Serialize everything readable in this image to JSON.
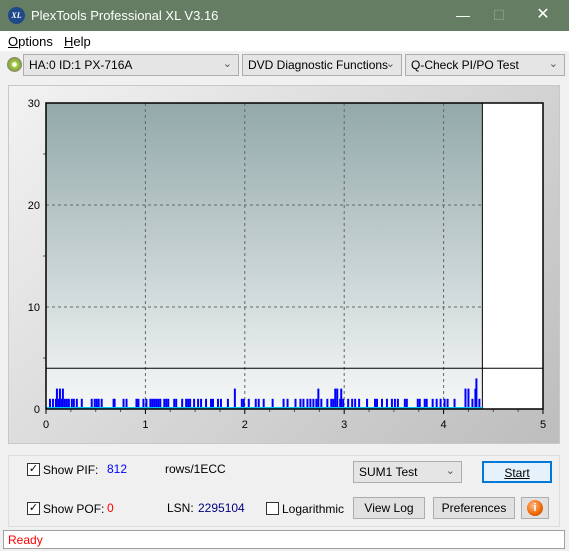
{
  "window": {
    "title": "PlexTools Professional XL V3.16",
    "logo_text": "XL"
  },
  "menu": [
    {
      "label": "Options",
      "hotkey": "O",
      "rest": "ptions"
    },
    {
      "label": "Help",
      "hotkey": "H",
      "rest": "elp"
    }
  ],
  "toolbar": {
    "drive": "HA:0 ID:1  PX-716A",
    "function": "DVD Diagnostic Functions",
    "test": "Q-Check PI/PO Test"
  },
  "chart_data": {
    "type": "bar",
    "xlim": [
      0,
      5
    ],
    "ylim": [
      0,
      30
    ],
    "x_ticks": [
      "0",
      "1",
      "2",
      "3",
      "4",
      "5"
    ],
    "y_ticks": [
      "0",
      "10",
      "20",
      "30"
    ],
    "grid": true,
    "series_color": "#0000ff",
    "threshold_line": 4,
    "end_marker_x": 4.39,
    "bars": [
      [
        0.03,
        1
      ],
      [
        0.06,
        1
      ],
      [
        0.09,
        1
      ],
      [
        0.1,
        2
      ],
      [
        0.12,
        1
      ],
      [
        0.13,
        2
      ],
      [
        0.15,
        1
      ],
      [
        0.16,
        2
      ],
      [
        0.18,
        1
      ],
      [
        0.2,
        1
      ],
      [
        0.22,
        1
      ],
      [
        0.25,
        1
      ],
      [
        0.27,
        1
      ],
      [
        0.3,
        1
      ],
      [
        0.35,
        1
      ],
      [
        0.45,
        1
      ],
      [
        0.48,
        1
      ],
      [
        0.5,
        1
      ],
      [
        0.52,
        1
      ],
      [
        0.55,
        1
      ],
      [
        0.67,
        1
      ],
      [
        0.68,
        1
      ],
      [
        0.77,
        1
      ],
      [
        0.8,
        1
      ],
      [
        0.9,
        1
      ],
      [
        0.92,
        1
      ],
      [
        0.97,
        1
      ],
      [
        1.0,
        1
      ],
      [
        1.04,
        1
      ],
      [
        1.06,
        1
      ],
      [
        1.08,
        1
      ],
      [
        1.1,
        1
      ],
      [
        1.12,
        1
      ],
      [
        1.14,
        1
      ],
      [
        1.18,
        1
      ],
      [
        1.2,
        1
      ],
      [
        1.22,
        1
      ],
      [
        1.28,
        1
      ],
      [
        1.3,
        1
      ],
      [
        1.36,
        1
      ],
      [
        1.4,
        1
      ],
      [
        1.42,
        1
      ],
      [
        1.44,
        1
      ],
      [
        1.48,
        1
      ],
      [
        1.52,
        1
      ],
      [
        1.55,
        1
      ],
      [
        1.6,
        1
      ],
      [
        1.65,
        1
      ],
      [
        1.67,
        1
      ],
      [
        1.72,
        1
      ],
      [
        1.75,
        1
      ],
      [
        1.82,
        1
      ],
      [
        1.89,
        2
      ],
      [
        1.96,
        1
      ],
      [
        1.98,
        1
      ],
      [
        2.03,
        1
      ],
      [
        2.1,
        1
      ],
      [
        2.13,
        1
      ],
      [
        2.18,
        1
      ],
      [
        2.27,
        1
      ],
      [
        2.38,
        1
      ],
      [
        2.42,
        1
      ],
      [
        2.5,
        1
      ],
      [
        2.55,
        1
      ],
      [
        2.58,
        1
      ],
      [
        2.62,
        1
      ],
      [
        2.65,
        1
      ],
      [
        2.68,
        1
      ],
      [
        2.71,
        1
      ],
      [
        2.73,
        2
      ],
      [
        2.76,
        1
      ],
      [
        2.82,
        1
      ],
      [
        2.86,
        1
      ],
      [
        2.88,
        1
      ],
      [
        2.9,
        2
      ],
      [
        2.92,
        2
      ],
      [
        2.95,
        1
      ],
      [
        2.96,
        2
      ],
      [
        2.98,
        1
      ],
      [
        3.03,
        1
      ],
      [
        3.07,
        1
      ],
      [
        3.1,
        1
      ],
      [
        3.14,
        1
      ],
      [
        3.22,
        1
      ],
      [
        3.3,
        1
      ],
      [
        3.32,
        1
      ],
      [
        3.37,
        1
      ],
      [
        3.42,
        1
      ],
      [
        3.47,
        1
      ],
      [
        3.5,
        1
      ],
      [
        3.53,
        1
      ],
      [
        3.6,
        1
      ],
      [
        3.62,
        1
      ],
      [
        3.73,
        1
      ],
      [
        3.75,
        1
      ],
      [
        3.8,
        1
      ],
      [
        3.82,
        1
      ],
      [
        3.88,
        1
      ],
      [
        3.92,
        1
      ],
      [
        3.96,
        1
      ],
      [
        4.0,
        1
      ],
      [
        4.03,
        1
      ],
      [
        4.1,
        1
      ],
      [
        4.21,
        2
      ],
      [
        4.24,
        2
      ],
      [
        4.28,
        1
      ],
      [
        4.31,
        2
      ],
      [
        4.32,
        3
      ],
      [
        4.35,
        1
      ]
    ]
  },
  "controls": {
    "show_pif_label": "Show PIF:",
    "pif_value": "812",
    "rows_label": "rows/1ECC",
    "show_pof_label": "Show POF:",
    "pof_value": "0",
    "lsn_label": "LSN:",
    "lsn_value": "2295104",
    "logarithmic_label": "Logarithmic",
    "sum_test": "SUM1 Test",
    "start": "Start",
    "view_log": "View Log",
    "preferences": "Preferences",
    "show_pif_checked": true,
    "show_pof_checked": true,
    "logarithmic_checked": false
  },
  "status": "Ready"
}
